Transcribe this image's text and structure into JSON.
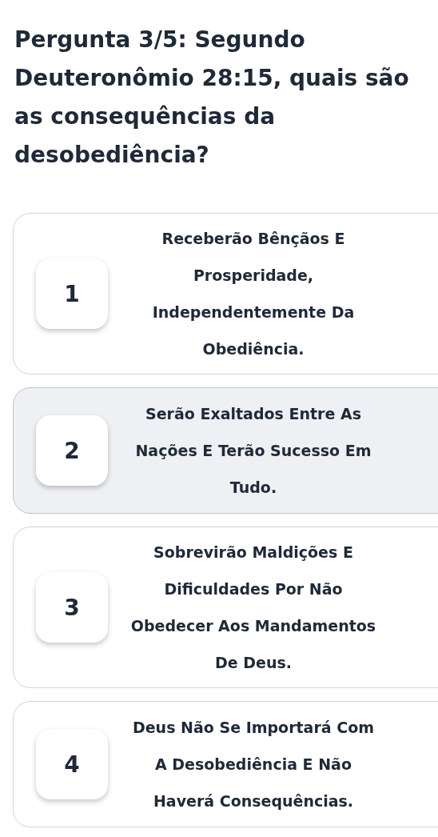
{
  "question": {
    "title": "Pergunta 3/5: Segundo Deuteronômio 28:15, quais são as consequências da desobediência?"
  },
  "options": [
    {
      "number": "1",
      "text": "Receberão Bênçãos E Prosperidade, Independentemente Da Obediência.",
      "selected": false
    },
    {
      "number": "2",
      "text": "Serão Exaltados Entre As Nações E Terão Sucesso Em Tudo.",
      "selected": true
    },
    {
      "number": "3",
      "text": "Sobrevirão Maldições E Dificuldades Por Não Obedecer Aos Mandamentos De Deus.",
      "selected": false
    },
    {
      "number": "4",
      "text": "Deus Não Se Importará Com A Desobediência E Não Haverá Consequências.",
      "selected": false
    }
  ]
}
